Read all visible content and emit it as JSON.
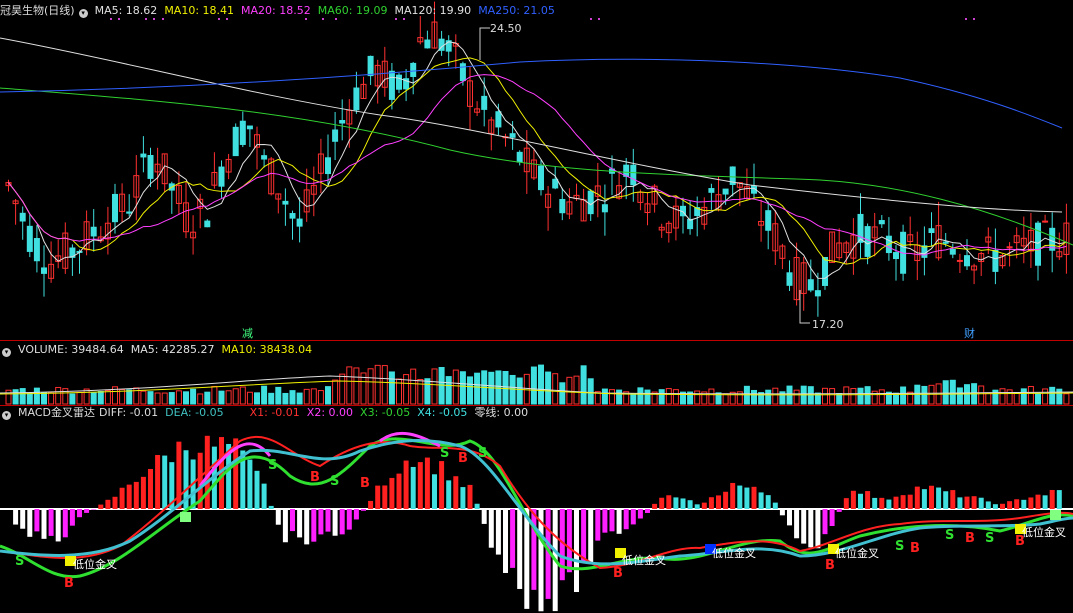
{
  "main": {
    "title": "冠昊生物(日线)",
    "ma_labels": [
      {
        "text": "MA5: 18.62",
        "color": "#e0e0e0"
      },
      {
        "text": "MA10: 18.41",
        "color": "#f0f000"
      },
      {
        "text": "MA20: 18.52",
        "color": "#ff40ff"
      },
      {
        "text": "MA60: 19.09",
        "color": "#30d030"
      },
      {
        "text": "MA120: 19.90",
        "color": "#e0e0e0"
      },
      {
        "text": "MA250: 21.05",
        "color": "#3060ff"
      }
    ],
    "high_label": "24.50",
    "low_label": "17.20",
    "event_reduce": "减",
    "event_finance": "财"
  },
  "volume": {
    "title": "VOLUME: 39484.64",
    "ma5": "MA5: 42285.27",
    "ma10": "MA10: 38438.04"
  },
  "macd": {
    "title": "MACD金叉雷达",
    "diff": "DIFF: -0.01",
    "dea": "DEA: -0.05",
    "x1": "X1: -0.01",
    "x2": "X2: 0.00",
    "x3": "X3: -0.05",
    "x4": "X4: -0.05",
    "zero": "零线: 0.00",
    "signal_text": "低位金叉",
    "buy_mark": "B",
    "sell_mark": "S"
  },
  "colors": {
    "up": "#ff3030",
    "down": "#40e0e0",
    "ma5": "#e0e0e0",
    "ma10": "#f0f000",
    "ma20": "#ff40ff",
    "ma60": "#30d030",
    "ma120": "#e0e0e0",
    "ma250": "#3060ff"
  }
}
